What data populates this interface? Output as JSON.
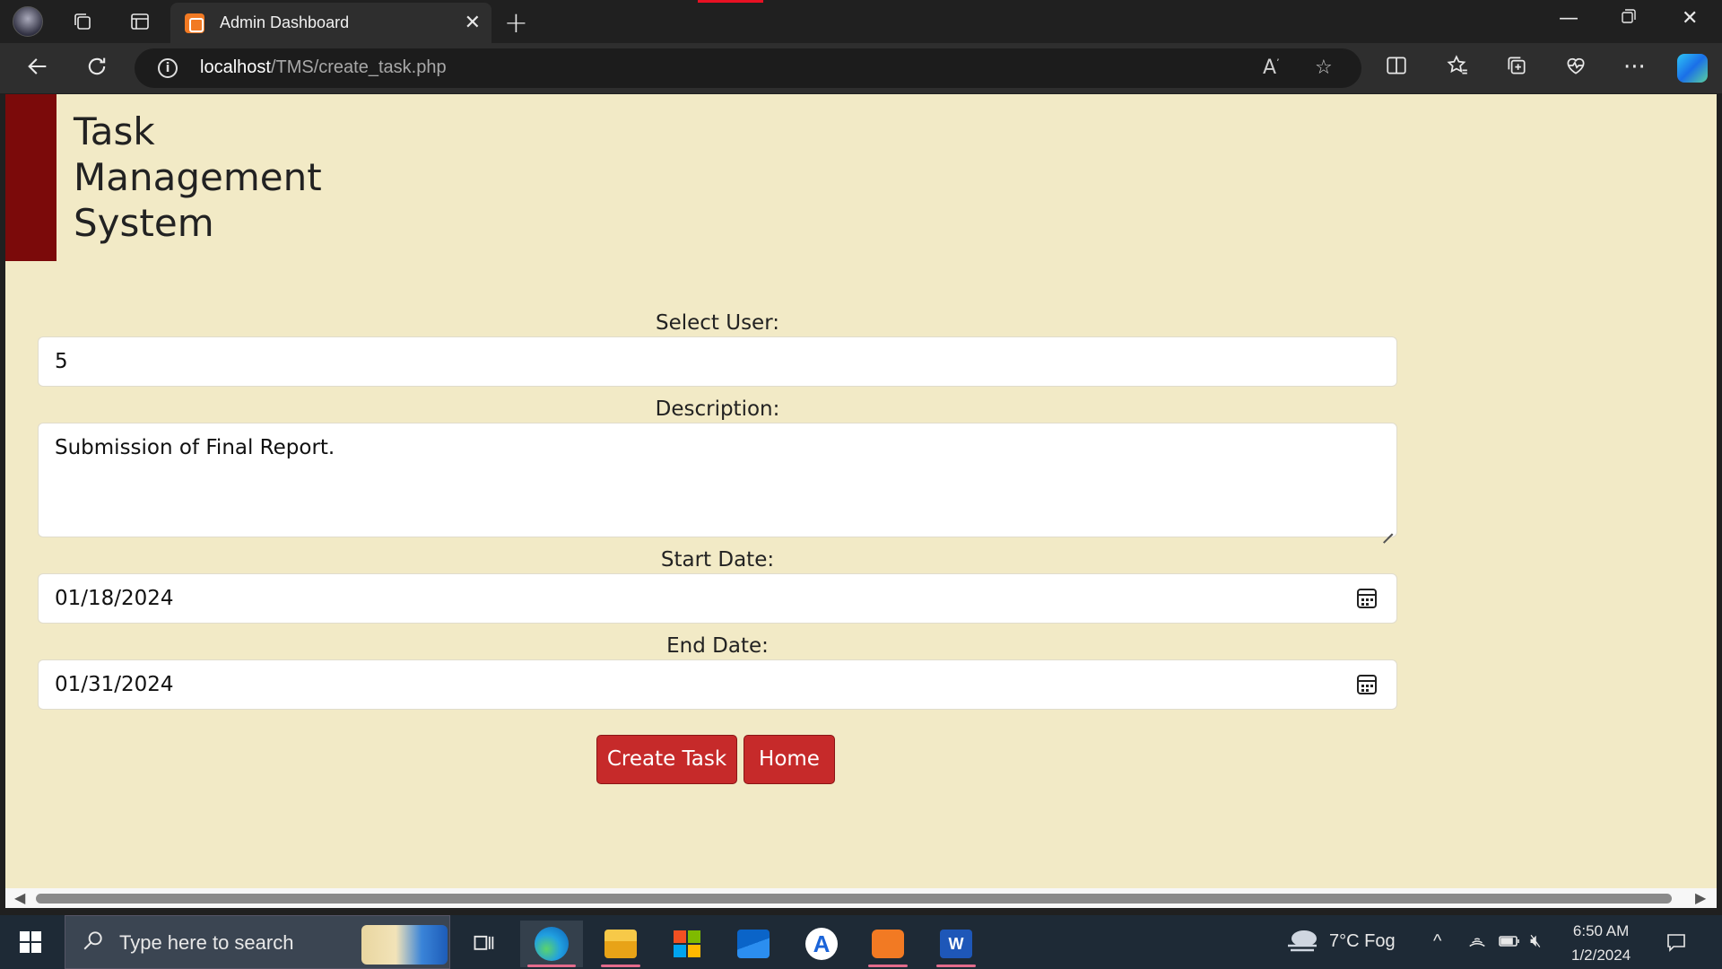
{
  "browser": {
    "tab_title": "Admin Dashboard",
    "url_host": "localhost",
    "url_path": "/TMS/create_task.php"
  },
  "page": {
    "brand_line1": "Task",
    "brand_line2": "Management",
    "brand_line3": "System",
    "colors": {
      "background": "#f2eac6",
      "brand_bar": "#7b0a0a",
      "button": "#c62a2a"
    }
  },
  "form": {
    "user_label": "Select User:",
    "user_value": "5",
    "description_label": "Description:",
    "description_value": "Submission of Final Report.",
    "start_label": "Start Date:",
    "start_value": "01/18/2024",
    "end_label": "End Date:",
    "end_value": "01/31/2024",
    "create_button": "Create Task",
    "home_button": "Home"
  },
  "taskbar": {
    "search_placeholder": "Type here to search",
    "weather": "7°C  Fog",
    "time": "6:50 AM",
    "date": "1/2/2024"
  }
}
